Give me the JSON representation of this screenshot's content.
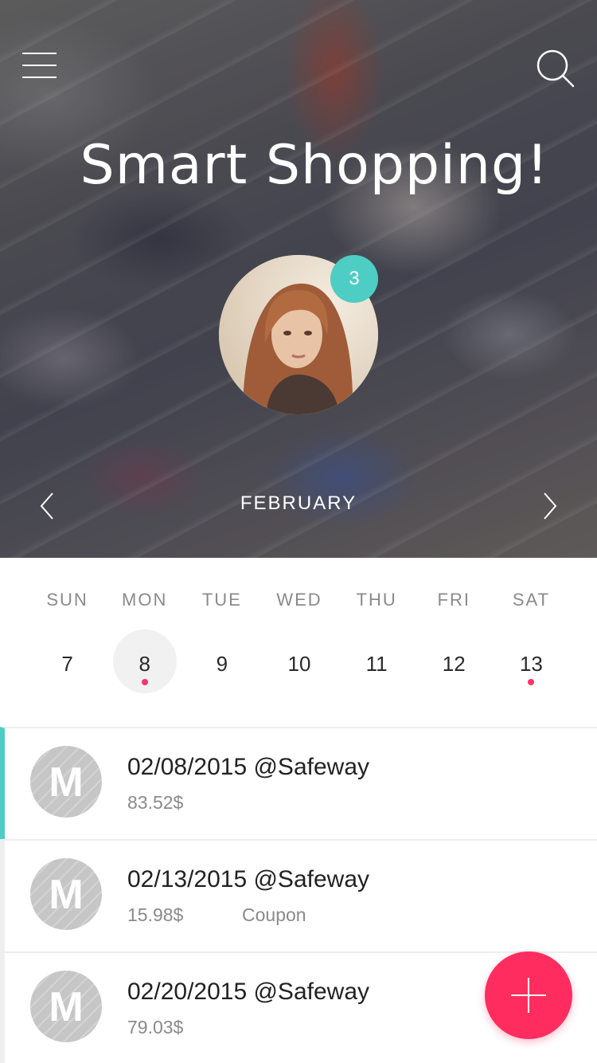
{
  "header": {
    "title": "Smart Shopping!",
    "notification_count": "3"
  },
  "calendar": {
    "month": "FEBRUARY",
    "weekdays": [
      "SUN",
      "MON",
      "TUE",
      "WED",
      "THU",
      "FRI",
      "SAT"
    ],
    "dates": [
      "7",
      "8",
      "9",
      "10",
      "11",
      "12",
      "13"
    ],
    "selected_date": "8",
    "dates_with_events": [
      "8",
      "13"
    ]
  },
  "receipts": [
    {
      "initial": "M",
      "title": "02/08/2015 @Safeway",
      "amount": "83.52$",
      "tag": "",
      "active": true
    },
    {
      "initial": "M",
      "title": "02/13/2015 @Safeway",
      "amount": "15.98$",
      "tag": "Coupon",
      "active": false
    },
    {
      "initial": "M",
      "title": "02/20/2015 @Safeway",
      "amount": "79.03$",
      "tag": "",
      "active": false
    }
  ],
  "colors": {
    "accent_teal": "#4ecdc4",
    "accent_pink": "#ff2d5f",
    "event_dot": "#ff3366"
  },
  "icons": {
    "menu": "hamburger-menu-icon",
    "search": "search-icon",
    "prev": "chevron-left-icon",
    "next": "chevron-right-icon",
    "add": "plus-icon"
  }
}
